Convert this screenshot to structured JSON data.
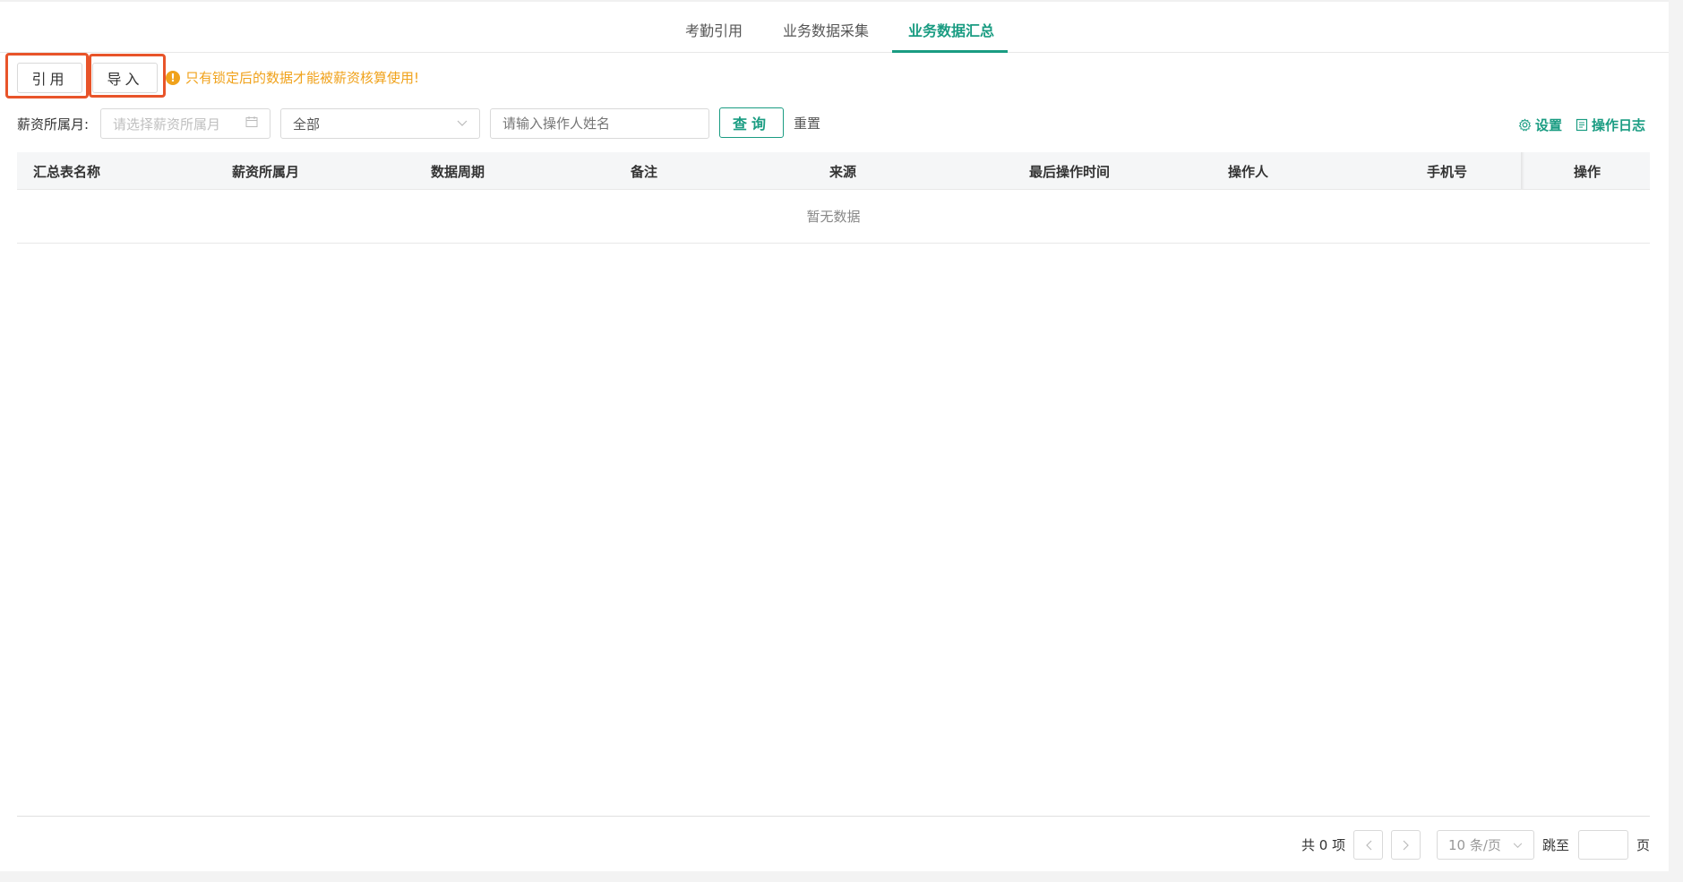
{
  "tabs": [
    {
      "label": "考勤引用"
    },
    {
      "label": "业务数据采集"
    },
    {
      "label": "业务数据汇总"
    }
  ],
  "actions": {
    "cite_label": "引用",
    "import_label": "导入",
    "tip": "只有锁定后的数据才能被薪资核算使用!"
  },
  "filters": {
    "month_label": "薪资所属月:",
    "month_placeholder": "请选择薪资所属月",
    "scope_value": "全部",
    "operator_placeholder": "请输入操作人姓名",
    "query_label": "查询",
    "reset_label": "重置"
  },
  "toolbar": {
    "settings_label": "设置",
    "log_label": "操作日志"
  },
  "table": {
    "columns": [
      "汇总表名称",
      "薪资所属月",
      "数据周期",
      "备注",
      "来源",
      "最后操作时间",
      "操作人",
      "手机号",
      "操作"
    ],
    "empty_text": "暂无数据"
  },
  "pagination": {
    "total": "共 0 项",
    "page_size": "10 条/页",
    "jump_label": "跳至",
    "page_unit": "页"
  },
  "colors": {
    "accent": "#1a9c82",
    "warning": "#f0a21b",
    "highlight_box": "#e8542a"
  }
}
